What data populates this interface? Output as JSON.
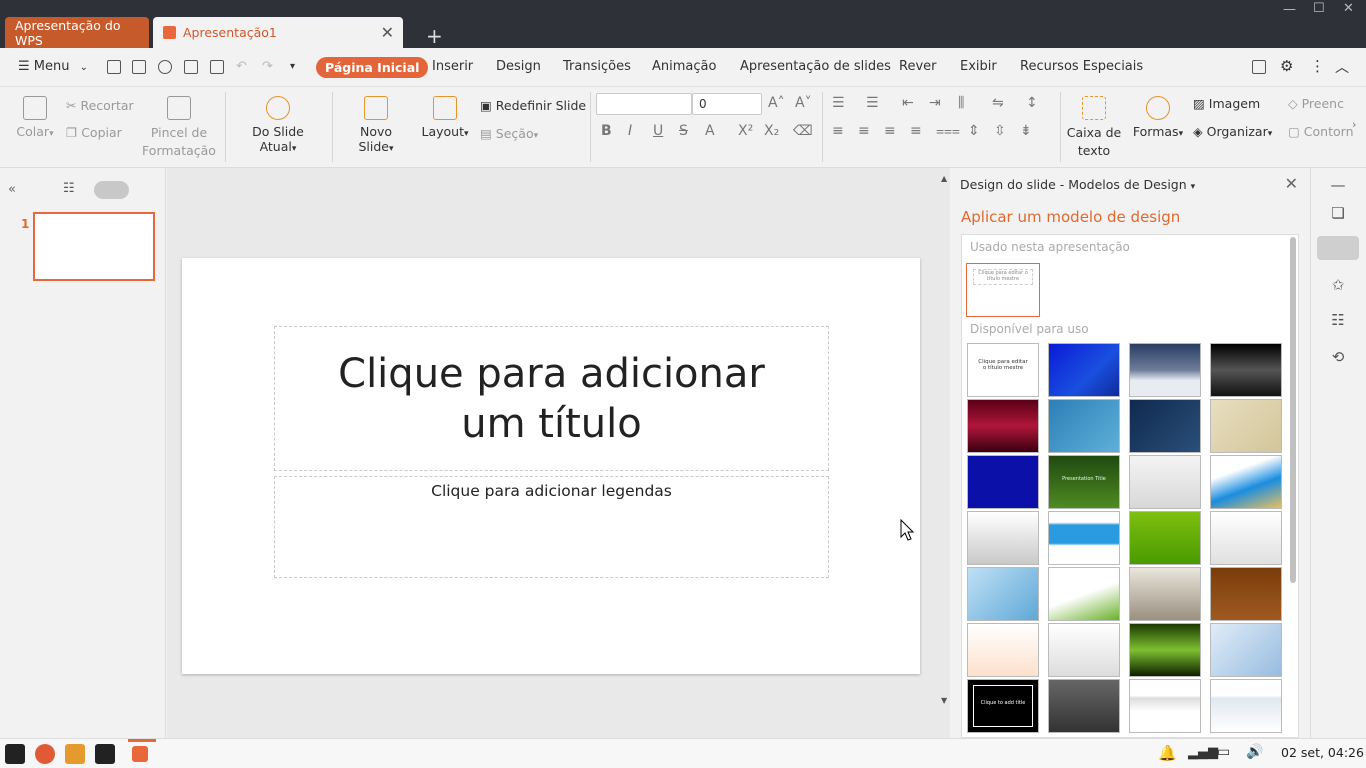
{
  "tabs": {
    "wps_home": "Apresentação do WPS",
    "document": "Apresentação1"
  },
  "menu": {
    "menu_label": "Menu",
    "tabs": [
      "Página Inicial",
      "Inserir",
      "Design",
      "Transições",
      "Animação",
      "Apresentação de slides",
      "Rever",
      "Exibir",
      "Recursos Especiais"
    ]
  },
  "ribbon": {
    "paste": "Colar",
    "cut": "Recortar",
    "copy": "Copiar",
    "format_painter": "Pincel de Formatação",
    "from_current": "Do Slide Atual",
    "new_slide": "Novo Slide",
    "layout": "Layout",
    "reset_slide": "Redefinir Slide",
    "section": "Seção",
    "font_size": "0",
    "text_box": "Caixa de texto",
    "shapes": "Formas",
    "image": "Imagem",
    "arrange": "Organizar",
    "fill": "Preenc",
    "outline": "Contorn"
  },
  "slides_panel": {
    "slide_number": "1"
  },
  "slide": {
    "title_placeholder": "Clique para adicionar um título",
    "subtitle_placeholder": "Clique para adicionar legendas"
  },
  "design_pane": {
    "title": "Design do slide - Modelos de Design",
    "apply_heading": "Aplicar um modelo de design",
    "used_section": "Usado nesta apresentação",
    "available_section": "Disponível para uso",
    "used_thumb_text": "Clique para editar o título mestre",
    "sample_thumb_text": "Clique para editar o título mestre",
    "black_thumb_text": "Clique to add title",
    "green_thumb_text": "Presentation Title"
  },
  "taskbar": {
    "clock": "02 set, 04:26"
  },
  "colors": {
    "accent": "#e4653a",
    "titlebar": "#2e3238"
  }
}
